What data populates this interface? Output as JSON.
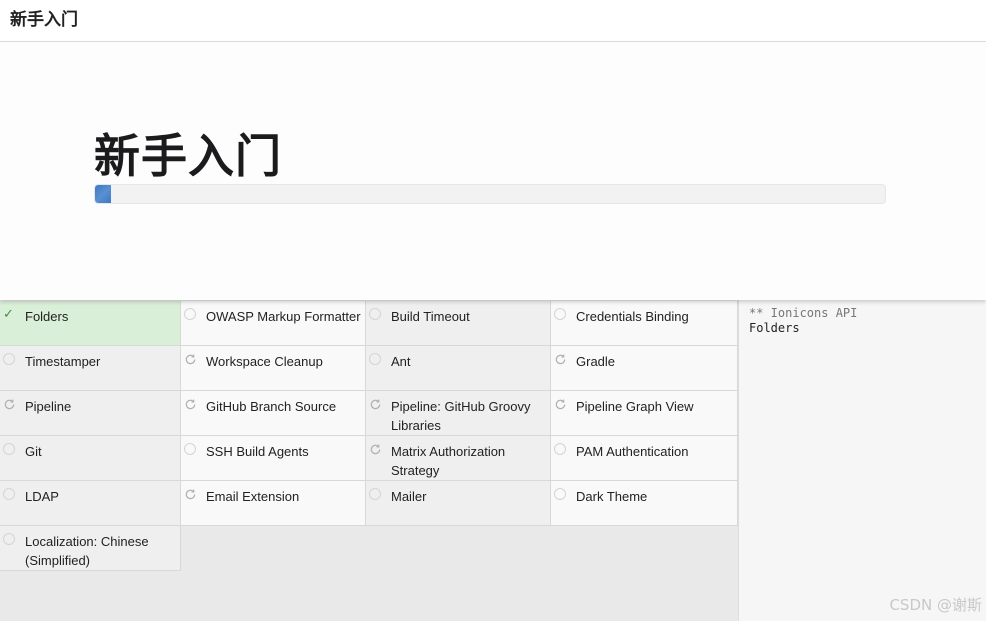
{
  "topbar": {
    "title": "新手入门"
  },
  "header": {
    "title": "新手入门",
    "progress_percent": 2
  },
  "plugins": [
    {
      "label": "Folders",
      "status": "installed"
    },
    {
      "label": "OWASP Markup Formatter",
      "status": "pending"
    },
    {
      "label": "Build Timeout",
      "status": "pending"
    },
    {
      "label": "Credentials Binding",
      "status": "pending"
    },
    {
      "label": "Timestamper",
      "status": "pending"
    },
    {
      "label": "Workspace Cleanup",
      "status": "dependency"
    },
    {
      "label": "Ant",
      "status": "pending"
    },
    {
      "label": "Gradle",
      "status": "dependency"
    },
    {
      "label": "Pipeline",
      "status": "dependency"
    },
    {
      "label": "GitHub Branch Source",
      "status": "dependency"
    },
    {
      "label": "Pipeline: GitHub Groovy Libraries",
      "status": "dependency"
    },
    {
      "label": "Pipeline Graph View",
      "status": "dependency"
    },
    {
      "label": "Git",
      "status": "pending"
    },
    {
      "label": "SSH Build Agents",
      "status": "pending"
    },
    {
      "label": "Matrix Authorization Strategy",
      "status": "dependency"
    },
    {
      "label": "PAM Authentication",
      "status": "pending"
    },
    {
      "label": "LDAP",
      "status": "pending"
    },
    {
      "label": "Email Extension",
      "status": "dependency"
    },
    {
      "label": "Mailer",
      "status": "pending"
    },
    {
      "label": "Dark Theme",
      "status": "pending"
    },
    {
      "label": "Localization: Chinese (Simplified)",
      "status": "pending"
    }
  ],
  "log": {
    "line1": "** Ionicons API",
    "line2": "Folders"
  },
  "watermark": "CSDN @谢斯"
}
